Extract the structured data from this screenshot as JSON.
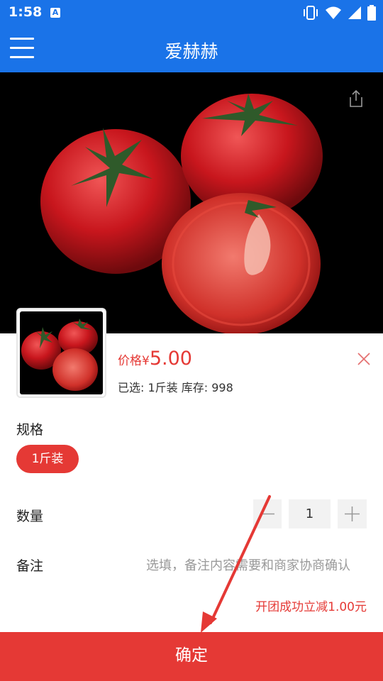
{
  "status_bar": {
    "time": "1:58",
    "notification_badge": "A",
    "icons": [
      "vibrate-icon",
      "wifi-icon",
      "signal-icon",
      "battery-icon"
    ]
  },
  "app_bar": {
    "title": "爱赫赫",
    "menu_icon": "hamburger-menu-icon"
  },
  "product": {
    "image_subject": "tomatoes",
    "share_icon": "share-icon"
  },
  "sheet": {
    "price_label": "价格¥",
    "price_value": "5.00",
    "selected_text": "已选: 1斤装  库存: 998",
    "close_icon": "close-icon",
    "spec_label": "规格",
    "spec_options": [
      "1斤装"
    ],
    "quantity_label": "数量",
    "quantity_value": "1",
    "remark_label": "备注",
    "remark_placeholder": "选填，备注内容需要和商家协商确认",
    "discount_text": "开团成功立减1.00元",
    "confirm_label": "确定"
  },
  "colors": {
    "primary_blue": "#1a73e8",
    "accent_red": "#e53935",
    "annotation_arrow": "#e53935"
  }
}
